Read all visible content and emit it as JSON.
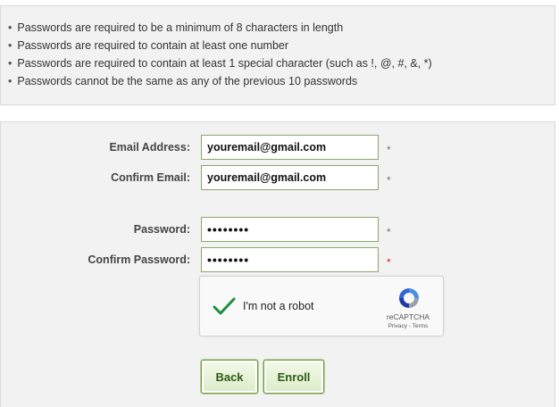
{
  "rules": [
    "Passwords are required to be a minimum of 8 characters in length",
    "Passwords are required to contain at least one number",
    "Passwords are required to contain at least 1 special character (such as !, @, #, &, *)",
    "Passwords cannot be the same as any of the previous 10 passwords"
  ],
  "form": {
    "email_label": "Email Address:",
    "email_value": "youremail@gmail.com",
    "confirm_email_label": "Confirm Email:",
    "confirm_email_value": "youremail@gmail.com",
    "password_label": "Password:",
    "password_value": "••••••••",
    "confirm_password_label": "Confirm Password:",
    "confirm_password_value": "••••••••",
    "required_marker": "*"
  },
  "captcha": {
    "label": "I'm not a robot",
    "brand": "reCAPTCHA",
    "terms": "Privacy - Terms"
  },
  "buttons": {
    "back": "Back",
    "enroll": "Enroll"
  },
  "colors": {
    "check": "#1e8e3e",
    "required_red": "#e02020",
    "button_text": "#2e5a14"
  }
}
